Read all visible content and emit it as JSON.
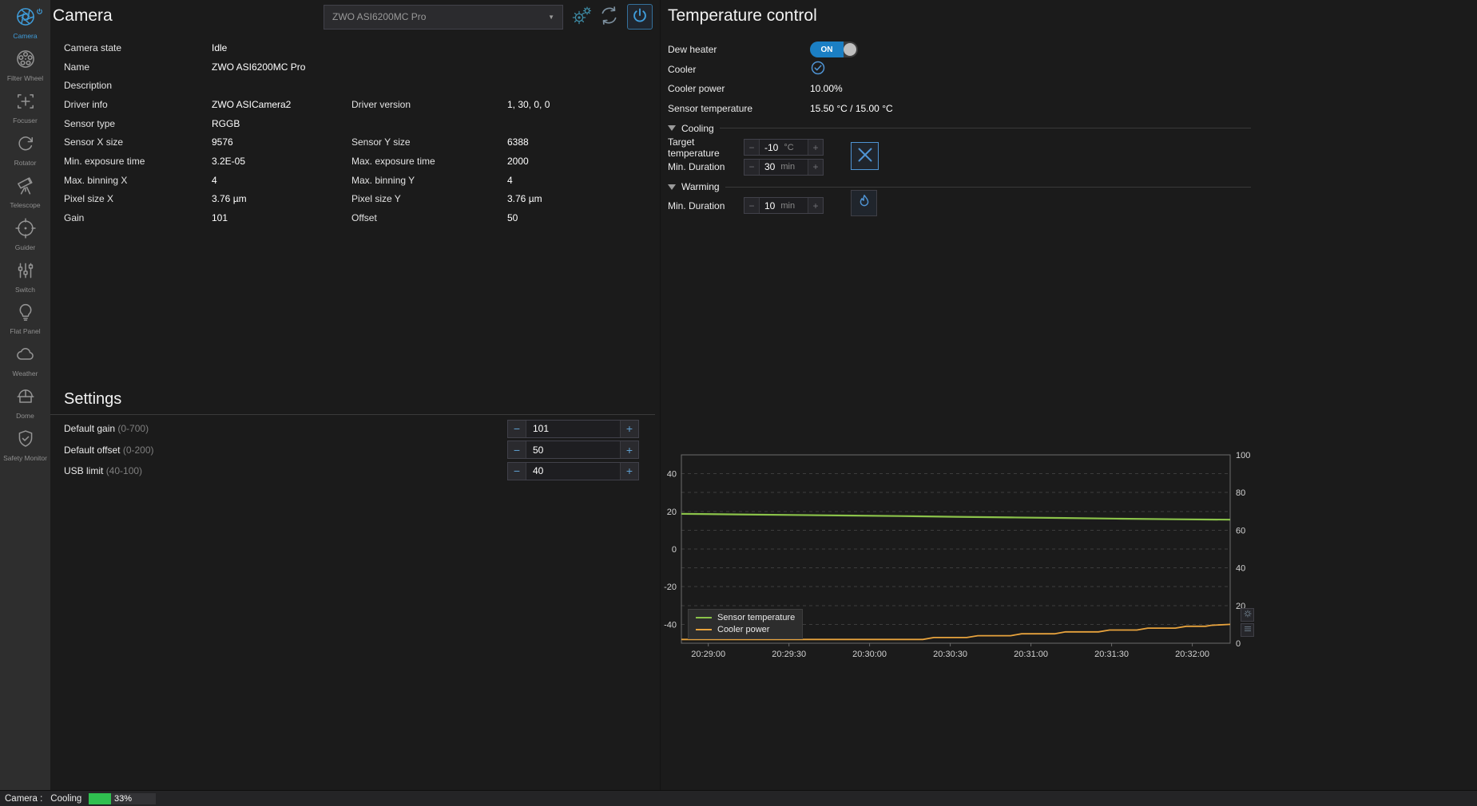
{
  "colors": {
    "accent": "#3f9ddb",
    "toggle_on": "#1b7fc4",
    "progress_green": "#2fbf4f",
    "series_temp": "#8bc34a",
    "series_power": "#e8a33d"
  },
  "sidebar": {
    "items": [
      {
        "id": "camera",
        "label": "Camera",
        "icon": "camera-icon",
        "active": true
      },
      {
        "id": "filter-wheel",
        "label": "Filter Wheel",
        "icon": "filter-wheel-icon",
        "active": false
      },
      {
        "id": "focuser",
        "label": "Focuser",
        "icon": "focuser-icon",
        "active": false
      },
      {
        "id": "rotator",
        "label": "Rotator",
        "icon": "rotator-icon",
        "active": false
      },
      {
        "id": "telescope",
        "label": "Telescope",
        "icon": "telescope-icon",
        "active": false
      },
      {
        "id": "guider",
        "label": "Guider",
        "icon": "guider-icon",
        "active": false
      },
      {
        "id": "switch",
        "label": "Switch",
        "icon": "switch-icon",
        "active": false
      },
      {
        "id": "flat-panel",
        "label": "Flat Panel",
        "icon": "flat-panel-icon",
        "active": false
      },
      {
        "id": "weather",
        "label": "Weather",
        "icon": "weather-icon",
        "active": false
      },
      {
        "id": "dome",
        "label": "Dome",
        "icon": "dome-icon",
        "active": false
      },
      {
        "id": "safety-monitor",
        "label": "Safety Monitor",
        "icon": "safety-monitor-icon",
        "active": false
      }
    ]
  },
  "header": {
    "title": "Camera",
    "device_selected": "ZWO ASI6200MC Pro"
  },
  "camera_info": {
    "rows": [
      {
        "label": "Camera state",
        "value": "Idle",
        "label2": "",
        "value2": ""
      },
      {
        "label": "Name",
        "value": "ZWO ASI6200MC Pro",
        "label2": "",
        "value2": ""
      },
      {
        "label": "Description",
        "value": "",
        "label2": "",
        "value2": ""
      },
      {
        "label": "Driver info",
        "value": "ZWO ASICamera2",
        "label2": "Driver version",
        "value2": "1, 30, 0, 0"
      },
      {
        "label": "Sensor type",
        "value": "RGGB",
        "label2": "",
        "value2": ""
      },
      {
        "label": "Sensor X size",
        "value": "9576",
        "label2": "Sensor Y size",
        "value2": "6388"
      },
      {
        "label": "Min. exposure time",
        "value": "3.2E-05",
        "label2": "Max. exposure time",
        "value2": "2000"
      },
      {
        "label": "Max. binning X",
        "value": "4",
        "label2": "Max. binning Y",
        "value2": "4"
      },
      {
        "label": "Pixel size X",
        "value": "3.76 µm",
        "label2": "Pixel size Y",
        "value2": "3.76 µm"
      },
      {
        "label": "Gain",
        "value": "101",
        "label2": "Offset",
        "value2": "50"
      }
    ]
  },
  "settings": {
    "title": "Settings",
    "rows": [
      {
        "label": "Default gain",
        "range": "(0-700)",
        "value": "101"
      },
      {
        "label": "Default offset",
        "range": "(0-200)",
        "value": "50"
      },
      {
        "label": "USB limit",
        "range": "(40-100)",
        "value": "40"
      }
    ]
  },
  "temperature": {
    "title": "Temperature control",
    "dew_heater": {
      "label": "Dew heater",
      "state": "ON"
    },
    "cooler": {
      "label": "Cooler",
      "checked": true
    },
    "cooler_power": {
      "label": "Cooler power",
      "value": "10.00%"
    },
    "sensor_temperature": {
      "label": "Sensor temperature",
      "value": "15.50 °C /  15.00 °C"
    },
    "cooling": {
      "section": "Cooling",
      "target_temperature": {
        "label": "Target temperature",
        "value": "-10",
        "unit": "°C"
      },
      "min_duration": {
        "label": "Min. Duration",
        "value": "30",
        "unit": "min"
      }
    },
    "warming": {
      "section": "Warming",
      "min_duration": {
        "label": "Min. Duration",
        "value": "10",
        "unit": "min"
      }
    }
  },
  "chart_data": {
    "type": "line",
    "x_ticks": [
      "20:29:00",
      "20:29:30",
      "20:30:00",
      "20:30:30",
      "20:31:00",
      "20:31:30",
      "20:32:00"
    ],
    "x_tick_fractions": [
      0.049,
      0.196,
      0.343,
      0.49,
      0.637,
      0.784,
      0.931
    ],
    "left_axis": {
      "ticks": [
        40,
        20,
        0,
        -20,
        -40
      ],
      "range": [
        -50,
        50
      ]
    },
    "right_axis": {
      "ticks": [
        100,
        80,
        60,
        40,
        20,
        0
      ],
      "range": [
        0,
        100
      ]
    },
    "grid": "dashed-horizontal",
    "legend_position": "bottom-left",
    "series": [
      {
        "name": "Sensor temperature",
        "color": "#8bc34a",
        "axis": "left",
        "points": [
          [
            0,
            18.7
          ],
          [
            0.1,
            18.4
          ],
          [
            0.2,
            18.1
          ],
          [
            0.3,
            17.8
          ],
          [
            0.4,
            17.5
          ],
          [
            0.5,
            17.1
          ],
          [
            0.6,
            16.8
          ],
          [
            0.7,
            16.5
          ],
          [
            0.8,
            16.1
          ],
          [
            0.9,
            15.8
          ],
          [
            1,
            15.6
          ]
        ]
      },
      {
        "name": "Cooler power",
        "color": "#e8a33d",
        "axis": "right",
        "points": [
          [
            0,
            2
          ],
          [
            0.44,
            2
          ],
          [
            0.46,
            3
          ],
          [
            0.52,
            3
          ],
          [
            0.54,
            4
          ],
          [
            0.6,
            4
          ],
          [
            0.62,
            5
          ],
          [
            0.68,
            5
          ],
          [
            0.7,
            6
          ],
          [
            0.76,
            6
          ],
          [
            0.78,
            7
          ],
          [
            0.83,
            7
          ],
          [
            0.85,
            8
          ],
          [
            0.9,
            8
          ],
          [
            0.92,
            9
          ],
          [
            0.955,
            9
          ],
          [
            0.965,
            9.5
          ],
          [
            1,
            10
          ]
        ]
      }
    ]
  },
  "statusbar": {
    "device_label": "Camera :",
    "status": "Cooling",
    "progress_percent": 33,
    "progress_label": "33%"
  }
}
